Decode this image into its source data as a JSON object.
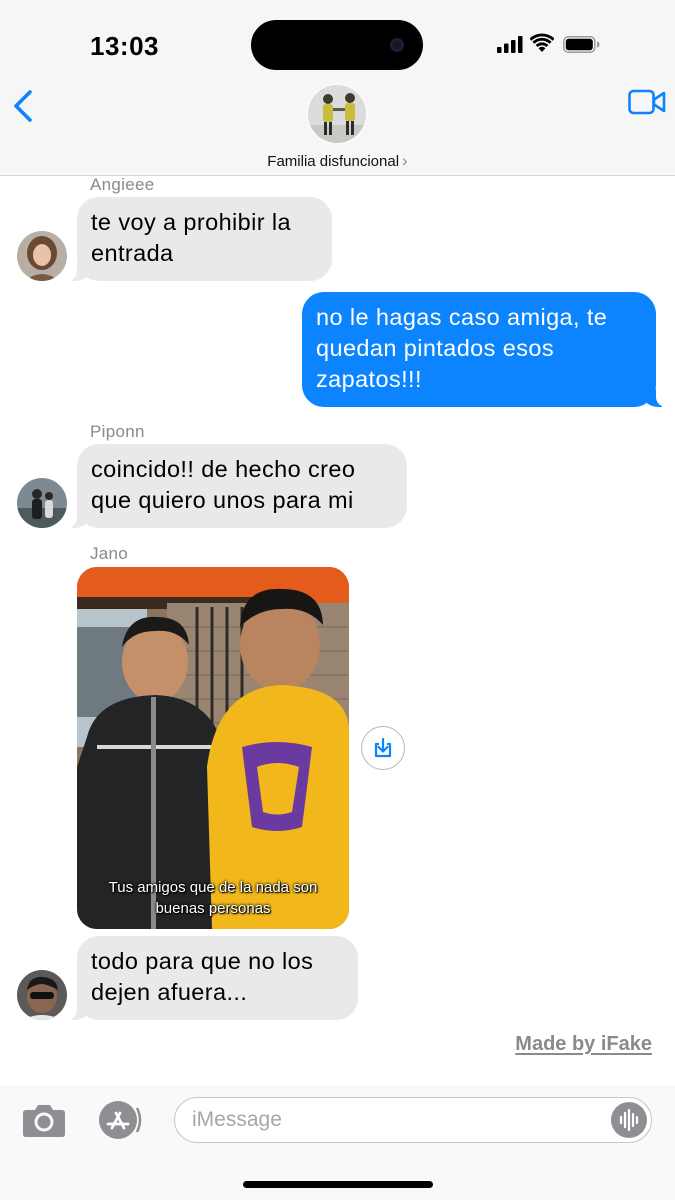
{
  "status_bar": {
    "time": "13:03"
  },
  "header": {
    "group_name": "Familia disfuncional",
    "chevron": "›",
    "back_icon": "chevron-left-icon",
    "video_icon": "video-camera-icon"
  },
  "messages": [
    {
      "sender": "Angieee",
      "direction": "incoming",
      "text": "te voy a prohibir la\nentrada"
    },
    {
      "direction": "outgoing",
      "text": "no le hagas caso amiga, te\nquedan pintados esos\nzapatos!!!"
    },
    {
      "sender": "Piponn",
      "direction": "incoming",
      "text": "coincido!! de hecho creo\nque quiero unos para mi"
    },
    {
      "sender": "Jano",
      "direction": "incoming",
      "type": "video",
      "caption": "Tus amigos que de la nada son\nbuenas personas"
    },
    {
      "direction": "incoming",
      "text": "todo para que no los\ndejen afuera..."
    }
  ],
  "watermark": "Made by iFake",
  "input_bar": {
    "placeholder": "iMessage",
    "value": ""
  },
  "colors": {
    "accent": "#0b84fe",
    "incoming_bubble": "#e9e9eb",
    "outgoing_bubble": "#0b84fe",
    "bar_background": "#f6f6f7",
    "secondary_text": "#8a8a8e"
  }
}
